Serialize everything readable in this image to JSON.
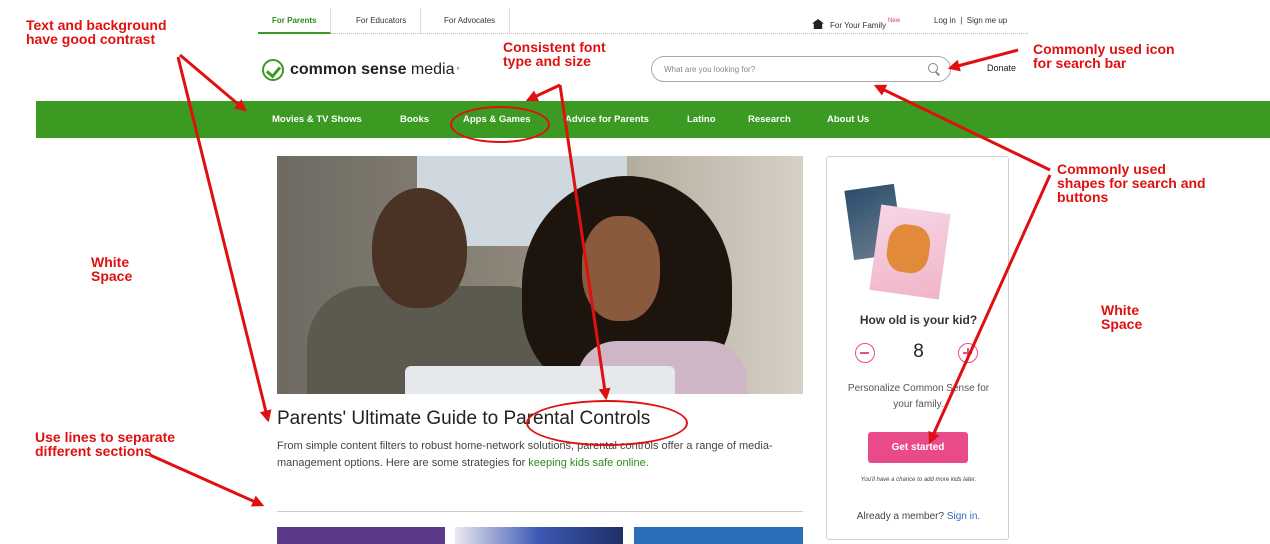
{
  "topbar": {
    "audience_tabs": [
      "For Parents",
      "For Educators",
      "For Advocates"
    ],
    "active_tab": "For Parents",
    "family_label": "For Your Family",
    "new_badge": "New",
    "login": "Log in  |  Sign me up"
  },
  "header": {
    "logo_bold": "common sense",
    "logo_rest": " media",
    "logo_mark": "°",
    "search_placeholder": "What are you looking for?",
    "donate": "Donate"
  },
  "nav": {
    "items": [
      "Movies & TV Shows",
      "Books",
      "Apps & Games",
      "Advice for Parents",
      "Latino",
      "Research",
      "About Us"
    ]
  },
  "article": {
    "headline": "Parents' Ultimate Guide to Parental Controls",
    "blurb": "From simple content filters to robust home-network solutions, parental controls offer a range of media-management options. Here are some strategies for ",
    "blurb_link": "keeping kids safe online."
  },
  "kid_card": {
    "question": "How old is your kid?",
    "age": "8",
    "personalize": "Personalize Common Sense for your family.",
    "cta": "Get started",
    "note": "You'll have a chance to add more kids later.",
    "member_prefix": "Already a member? ",
    "member_link": "Sign in."
  },
  "annotations": {
    "contrast": "Text and background\nhave good contrast",
    "font": "Consistent font\ntype and size",
    "search_icon": "Commonly used icon\nfor search bar",
    "shapes": "Commonly used\nshapes for search and\nbuttons",
    "white_space_left": "White\nSpace",
    "white_space_right": "White\nSpace",
    "lines": "Use lines to separate\ndifferent sections"
  },
  "colors": {
    "brand_green": "#3a9a22",
    "accent_pink": "#e84a8a",
    "annotation_red": "#e01010"
  }
}
